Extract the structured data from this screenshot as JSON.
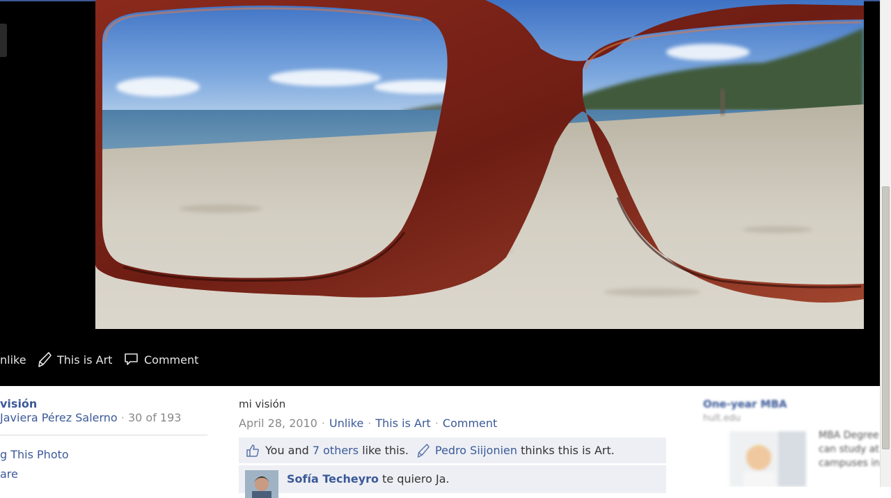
{
  "photo_actions": {
    "unlike": "nlike",
    "this_is_art": "This is Art",
    "comment": "Comment"
  },
  "album": {
    "title": "visión",
    "owner": "Javiera Pérez Salerno",
    "position": "30 of 193",
    "tag_photo": "g This Photo",
    "share": "are"
  },
  "caption": "mi visión",
  "meta": {
    "date": "April 28, 2010",
    "unlike": "Unlike",
    "this_is_art": "This is Art",
    "comment": "Comment"
  },
  "likes": {
    "prefix": "You and",
    "others_link": "7 others",
    "suffix": "like this.",
    "art_person": "Pedro Siijonien",
    "art_suffix": "thinks this is Art."
  },
  "comments": [
    {
      "author": "Sofía Techeyro",
      "text": "te quiero Ja."
    }
  ],
  "ad": {
    "title": "One-year MBA",
    "url": "hult.edu",
    "body": "MBA Degree can study at campuses in"
  },
  "icons": {
    "like": "thumbs-up-icon",
    "art": "quill-icon",
    "comment": "speech-bubble-icon"
  },
  "colors": {
    "link": "#3b5998",
    "viewer_bg": "#000000",
    "feedback_bg": "#edeff4"
  }
}
